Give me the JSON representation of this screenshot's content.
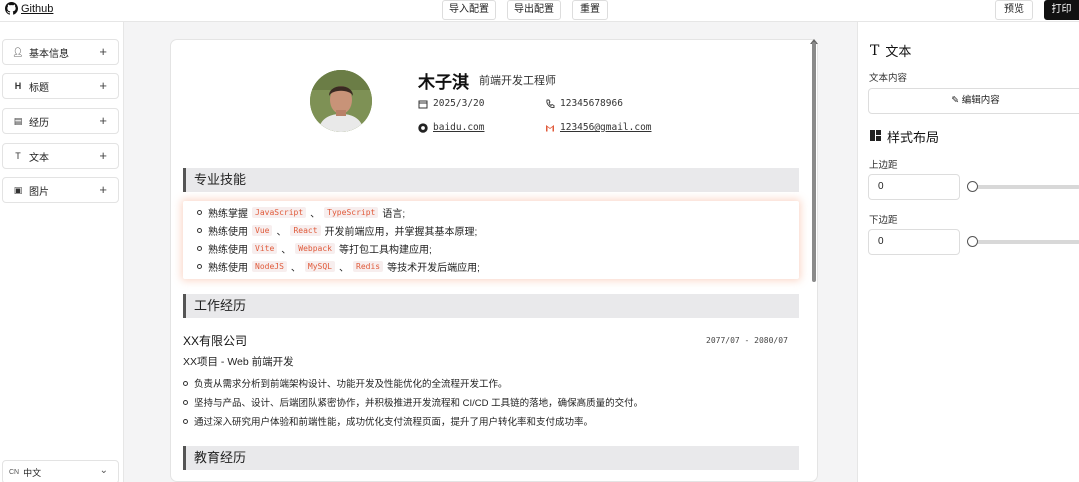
{
  "topbar": {
    "github_label": "Github",
    "import_label": "导入配置",
    "export_label": "导出配置",
    "reset_label": "重置",
    "preview_label": "预览",
    "print_label": "打印"
  },
  "sidebar": {
    "items": [
      {
        "label": "基本信息",
        "icon": "user-icon"
      },
      {
        "label": "标题",
        "icon": "heading-icon"
      },
      {
        "label": "经历",
        "icon": "briefcase-icon"
      },
      {
        "label": "文本",
        "icon": "text-icon"
      },
      {
        "label": "图片",
        "icon": "image-icon"
      }
    ],
    "language_code": "CN",
    "language_label": "中文"
  },
  "resume": {
    "name": "木子淇",
    "role": "前端开发工程师",
    "birth": "2025/3/20",
    "phone": "12345678966",
    "website": "baidu.com",
    "email": "123456@gmail.com",
    "skills_title": "专业技能",
    "skills": [
      {
        "pre": "熟练掌握",
        "codes": [
          "JavaScript",
          "TypeScript"
        ],
        "sep": "、",
        "post": "语言;"
      },
      {
        "pre": "熟练使用",
        "codes": [
          "Vue",
          "React"
        ],
        "sep": "、",
        "post": "开发前端应用，并掌握其基本原理;"
      },
      {
        "pre": "熟练使用",
        "codes": [
          "Vite",
          "Webpack"
        ],
        "sep": "、",
        "post": "等打包工具构建应用;"
      },
      {
        "pre": "熟练使用",
        "codes": [
          "NodeJS",
          "MySQL",
          "Redis"
        ],
        "sep": "、",
        "post": "等技术开发后端应用;"
      }
    ],
    "work_title": "工作经历",
    "company": "XX有限公司",
    "date_range": "2077/07 - 2080/07",
    "project": "XX项目 - Web 前端开发",
    "work_items": [
      "负责从需求分析到前端架构设计、功能开发及性能优化的全流程开发工作。",
      "坚持与产品、设计、后端团队紧密协作，并积极推进开发流程和 CI/CD 工具链的落地，确保高质量的交付。",
      "通过深入研究用户体验和前端性能，成功优化支付流程页面，提升了用户转化率和支付成功率。"
    ],
    "edu_title": "教育经历"
  },
  "panel": {
    "text_title": "文本",
    "content_label": "文本内容",
    "edit_label": "编辑内容",
    "layout_title": "样式布局",
    "top_margin_label": "上边距",
    "top_margin_value": "0",
    "bottom_margin_label": "下边距",
    "bottom_margin_value": "0"
  }
}
